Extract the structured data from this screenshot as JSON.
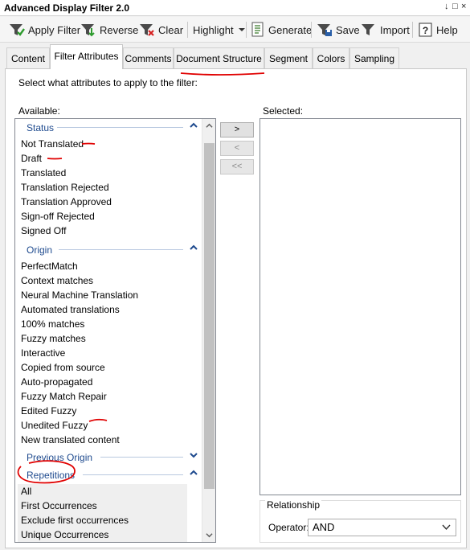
{
  "window": {
    "title": "Advanced Display Filter 2.0",
    "controls": [
      "↓",
      "□",
      "×"
    ]
  },
  "toolbar": {
    "apply_filter": "Apply Filter",
    "reverse": "Reverse",
    "clear": "Clear",
    "highlight": "Highlight",
    "generate": "Generate",
    "save": "Save",
    "import": "Import",
    "help": "Help"
  },
  "tabs": [
    "Content",
    "Filter Attributes",
    "Comments",
    "Document Structure",
    "Segment",
    "Colors",
    "Sampling"
  ],
  "active_tab": "Filter Attributes",
  "instruction": "Select what attributes to apply to the filter:",
  "available_label": "Available:",
  "selected_label": "Selected:",
  "groups": {
    "status": {
      "name": "Status",
      "items": [
        "Not Translated",
        "Draft",
        "Translated",
        "Translation Rejected",
        "Translation Approved",
        "Sign-off Rejected",
        "Signed Off"
      ]
    },
    "origin": {
      "name": "Origin",
      "items": [
        "PerfectMatch",
        "Context matches",
        "Neural Machine Translation",
        "Automated translations",
        "100% matches",
        "Fuzzy matches",
        "Interactive",
        "Copied from source",
        "Auto-propagated",
        "Fuzzy Match Repair",
        "Edited Fuzzy",
        "Unedited Fuzzy",
        "New translated content"
      ]
    },
    "previous_origin": {
      "name": "Previous Origin"
    },
    "repetitions": {
      "name": "Repetitions",
      "items": [
        "All",
        "First Occurrences",
        "Exclude first occurrences",
        "Unique Occurrences"
      ]
    }
  },
  "move_buttons": {
    "add": ">",
    "remove": "<",
    "remove_all": "<<"
  },
  "relationship": {
    "legend": "Relationship",
    "operator_label": "Operator:",
    "operator_value": "AND"
  },
  "colors": {
    "group_header": "#1e4a8e",
    "annotation": "#e00000"
  }
}
